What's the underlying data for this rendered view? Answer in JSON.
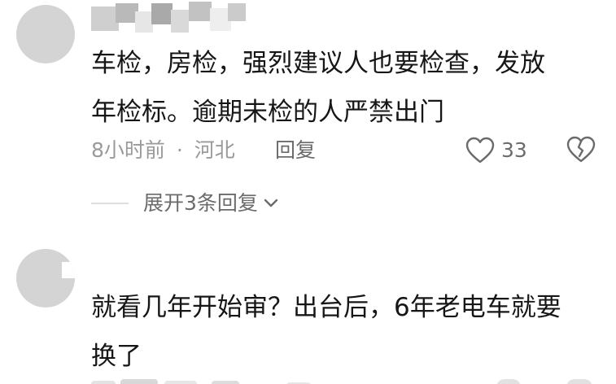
{
  "comments": [
    {
      "text_line1": "车检，房检，强烈建议人也要检查，发放",
      "text_line2": "年检标。逾期未检的人严禁出门",
      "time": "8小时前",
      "separator": "·",
      "location": "河北",
      "reply_label": "回复",
      "like_count": "33",
      "expand_label": "展开3条回复"
    },
    {
      "text_line1": "就看几年开始审？出台后，6年老电车就要",
      "text_line2": "换了"
    }
  ],
  "icons": {
    "like": "heart-outline-icon",
    "dislike": "broken-heart-icon",
    "expand": "chevron-down-icon"
  },
  "colors": {
    "text": "#161616",
    "meta": "#9a9a9a",
    "secondary": "#6b6b6b",
    "avatar": "#d4d4d4"
  }
}
